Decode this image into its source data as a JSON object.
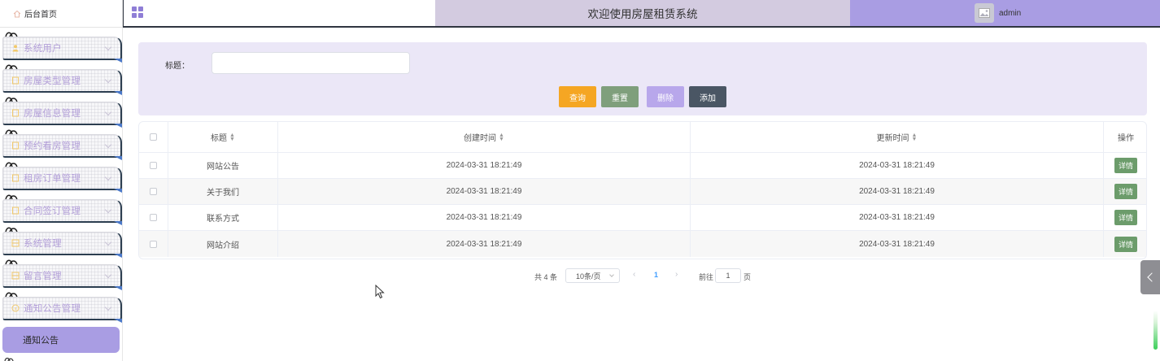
{
  "sidebar": {
    "home": "后台首页",
    "items": [
      {
        "label": "系统用户"
      },
      {
        "label": "房屋类型管理"
      },
      {
        "label": "房屋信息管理"
      },
      {
        "label": "预约看房管理"
      },
      {
        "label": "租房订单管理"
      },
      {
        "label": "合同签订管理"
      },
      {
        "label": "系统管理"
      },
      {
        "label": "留言管理"
      },
      {
        "label": "通知公告管理"
      }
    ],
    "active_sub": "通知公告"
  },
  "header": {
    "title": "欢迎使用房屋租赁系统",
    "user": "admin"
  },
  "search": {
    "label": "标题：",
    "value": "",
    "placeholder": ""
  },
  "toolbar": {
    "query": "查询",
    "reset": "重置",
    "delete": "删除",
    "add": "添加"
  },
  "table": {
    "headers": {
      "title": "标题",
      "created": "创建时间",
      "updated": "更新时间",
      "actions": "操作"
    },
    "rows": [
      {
        "title": "网站公告",
        "created": "2024-03-31 18:21:49",
        "updated": "2024-03-31 18:21:49",
        "action": "详情"
      },
      {
        "title": "关于我们",
        "created": "2024-03-31 18:21:49",
        "updated": "2024-03-31 18:21:49",
        "action": "详情"
      },
      {
        "title": "联系方式",
        "created": "2024-03-31 18:21:49",
        "updated": "2024-03-31 18:21:49",
        "action": "详情"
      },
      {
        "title": "网站介绍",
        "created": "2024-03-31 18:21:49",
        "updated": "2024-03-31 18:21:49",
        "action": "详情"
      }
    ]
  },
  "pagination": {
    "total": "共 4 条",
    "page_size": "10条/页",
    "current": "1",
    "goto_label": "前往",
    "goto_value": "1",
    "page_suffix": "页"
  },
  "colors": {
    "accent": "#a99de3",
    "header_mid": "#d3cbe0",
    "query_btn": "#f5a623",
    "reset_btn": "#7f9f7c",
    "delete_btn": "#b8a7eb",
    "add_btn": "#4a5664",
    "detail_btn": "#6c9c6b"
  },
  "icons": {
    "home": "home-icon",
    "grid": "grid-menu-icon",
    "avatar": "image-icon",
    "sort": "sort-icon",
    "collapse": "chevron-left-icon"
  }
}
